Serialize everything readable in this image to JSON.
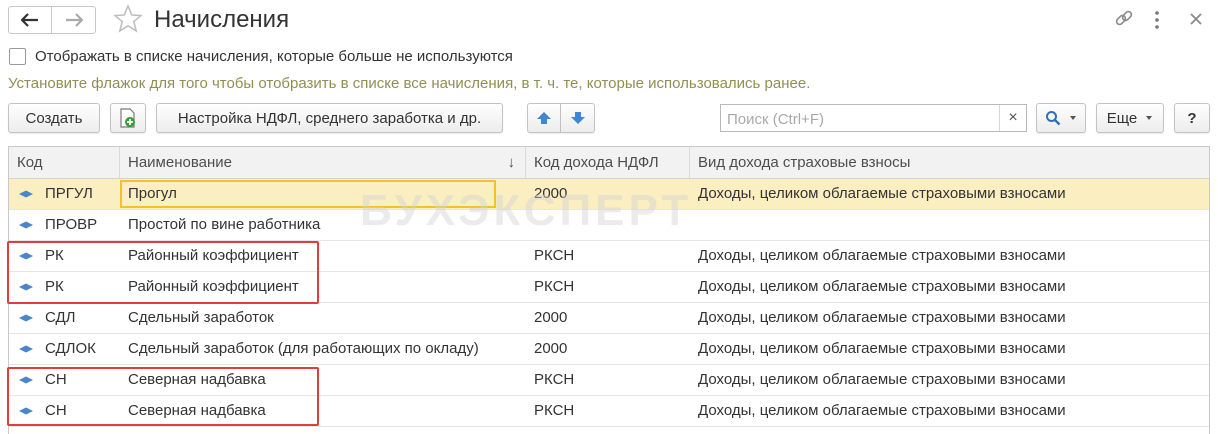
{
  "window": {
    "title": "Начисления",
    "nav_back_icon": "arrow-left-icon",
    "nav_forward_icon": "arrow-right-icon",
    "favorite_icon": "star-icon",
    "link_icon": "link-icon",
    "menu_icon": "vertical-dots-icon",
    "close_icon": "close-icon"
  },
  "filter": {
    "checkbox_label": "Отображать в списке начисления, которые больше не используются",
    "checked": false,
    "hint": "Установите флажок для того чтобы отобразить в списке все начисления, в т. ч. те, которые использовались ранее."
  },
  "toolbar": {
    "create_label": "Создать",
    "settings_label": "Настройка НДФЛ, среднего заработка и др.",
    "search_placeholder": "Поиск (Ctrl+F)",
    "search_clear": "×",
    "more_label": "Еще",
    "help_label": "?"
  },
  "table": {
    "columns": [
      "Код",
      "Наименование",
      "Код дохода НДФЛ",
      "Вид дохода страховые взносы"
    ],
    "sort_indicator": "↓",
    "rows": [
      {
        "code": "ПРГУЛ",
        "name": "Прогул",
        "ndfl": "2000",
        "vid": "Доходы, целиком облагаемые страховыми взносами",
        "selected": true
      },
      {
        "code": "ПРОВР",
        "name": "Простой по вине работника",
        "ndfl": "",
        "vid": ""
      },
      {
        "code": "РК",
        "name": "Районный коэффициент",
        "ndfl": "РКСН",
        "vid": "Доходы, целиком облагаемые страховыми взносами"
      },
      {
        "code": "РК",
        "name": "Районный коэффициент",
        "ndfl": "РКСН",
        "vid": "Доходы, целиком облагаемые страховыми взносами"
      },
      {
        "code": "СДЛ",
        "name": "Сдельный заработок",
        "ndfl": "2000",
        "vid": "Доходы, целиком облагаемые страховыми взносами"
      },
      {
        "code": "СДЛОК",
        "name": "Сдельный заработок (для работающих по окладу)",
        "ndfl": "2000",
        "vid": "Доходы, целиком облагаемые страховыми взносами"
      },
      {
        "code": "СН",
        "name": "Северная надбавка",
        "ndfl": "РКСН",
        "vid": "Доходы, целиком облагаемые страховыми взносами"
      },
      {
        "code": "СН",
        "name": "Северная надбавка",
        "ndfl": "РКСН",
        "vid": "Доходы, целиком облагаемые страховыми взносами"
      }
    ]
  },
  "watermark": "БУХЭКСПЕРТ",
  "colors": {
    "selected_row": "#fbeec0",
    "selected_cell_border": "#f2c12e",
    "highlight_box": "#e23d3d",
    "hint_text": "#8f8f54",
    "row_marker": "#4a86c8"
  }
}
